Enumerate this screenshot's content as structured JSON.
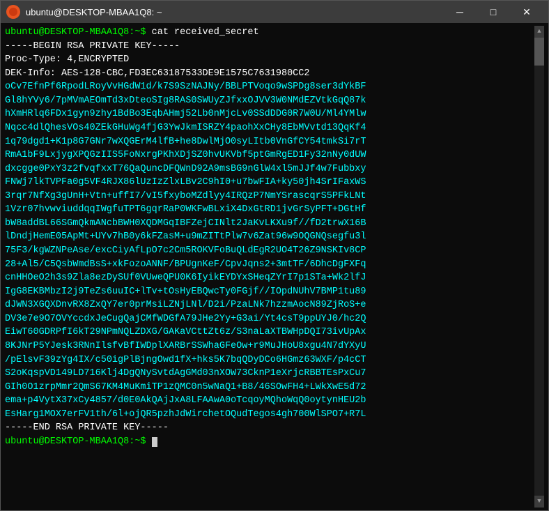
{
  "titlebar": {
    "title": "ubuntu@DESKTOP-MBAA1Q8: ~",
    "minimize_label": "─",
    "maximize_label": "□",
    "close_label": "✕"
  },
  "terminal": {
    "prompt1": "ubuntu@DESKTOP-MBAA1Q8:~$ ",
    "command1": "cat received_secret",
    "lines": [
      "-----BEGIN RSA PRIVATE KEY-----",
      "Proc-Type: 4,ENCRYPTED",
      "DEK-Info: AES-128-CBC,FD3EC63187533DE9E1575C7631980CC2",
      "",
      "oCv7EfnPf6RpodLRoyVvHGdW1d/k7S9SzNAJNy/BBLPTVoqo9wSPDg8ser3dYkBF",
      "Gl8hYVy6/7pMVmAEOmTd3xDteoSIg8RAS0SWUyZJfxxOJVV3W0NMdEZVtkGqQ87k",
      "hXmHRlq6FDx1gyn9zhy1BdBo3EqbAHmj52Lb0nMjcLv0SSdDDG0R7W0U/Ml4YMlw",
      "Nqcc4dlQhesVOs40ZEkGHuWg4fjG3YwJkmISRZY4paohXxCHy8EbMVvtd13QqKf4",
      "1q79dgd1+K1p8G7GNr7wXQGErM4lfB+he8DwlMjO0syLItb0VnGfCY54tmkSi7rT",
      "RmA1bF9LxjygXPQGzIIS5FoNxrgPKhXDjSZ0hvUKVbf5ptGmRgED1Fy32nNy0dUW",
      "dxcgge0PxY3z2fvqfxxT76QaQuncDFQWnD92A9msBG9nGlW4xl5mJJf4w7Fubbxy",
      "FNWj7lkTVPFa0g5VF4RJX86lUzIzZlxLBv2C9hI0+u7bwFIA+ky50jh4SrIFaxWS",
      "3rqr7NfXg3gUnH+Vtn+uffI7/vI5fxyboMZdlyy4IRQzP7NmYSrascqrS5PFkLNt",
      "1Vzr07hvwviuddqqIWgfuTPT6gqrRaP0WKFwBLxiX4DxGtRD1jvGrSyPFT+DGtHf",
      "bW8addBL66SGmQkmANcbBWH0XQDMGqIBFZejCINlt2JaKvLKXu9f//fD2trwX16B",
      "lDndjHemE05ApMt+UYv7hB0y6kFZasM+u9mZITtPlw7v6Zat96w9OQGNQsegfu3l",
      "75F3/kgWZNPeAse/excCiyAfLpO7c2Cm5ROKVFoBuQLdEgR2UO4T26Z9NSKIv8CP",
      "28+Al5/C5QsbWmdBsS+xkFozoANNF/BPUgnKeF/CpvJqns2+3mtTF/6DhcDgFXFq",
      "cnHHOeO2h3s9Zla8ezDySUf0VUweQPU0K6IyikEYDYxSHeqZYrI7p1STa+Wk2lfJ",
      "IgG8EKBMbzI2j9TeZs6uuIC+lTv+tOsHyEBQwcTy0FGjf//IOpdNUhV7BMP1tu89",
      "dJWN3XGQXDnvRX8ZxQY7er0prMsiLZNjLNl/D2i/PzaLNk7hzzmAocN89ZjRoS+e",
      "DV3e7e9O7OVYccdxJeCugQajCMfWDGfA79JHe2Yy+G3ai/Yt4csT9ppUYJ0/hc2Q",
      "EiwT60GDRPfI6kT29NPmNQLZDXG/GAKaVCttZt6z/S3naLaXTBWHpDQI73ivUpAx",
      "8KJNrP5YJesk3RNnIlsfvBfIWDplXARBrSSWhaGFeOw+r9MuJHoU8xgu4N7dYXyU",
      "/pElsvF39zYg4IX/c50igPlBjngOwd1fX+hks5K7bqQDyDCo6HGmz63WXF/p4cCT",
      "S2oKqspVD149LD716Klj4DgQNySvtdAgGMd03nXOW73CknP1eXrjcRBBTEsPxCu7",
      "GIh0O1zrpMmr2QmS67KM4MuKmiTP1zQMC0n5wNaQ1+B8/46SOwFH4+LWkXwE5d72",
      "ema+p4VytX37xCy4857/d0E0AkQAjJxA8LFAAwA0oTcqoyMQhoWqQ0oytynHEU2b",
      "EsHarg1MOX7erFV1th/6l+ojQR5pzhJdWirchetOQudTegos4gh700WlSPO7+R7L",
      "-----END RSA PRIVATE KEY-----"
    ],
    "prompt2": "ubuntu@DESKTOP-MBAA1Q8:~$ ",
    "cursor": true
  }
}
